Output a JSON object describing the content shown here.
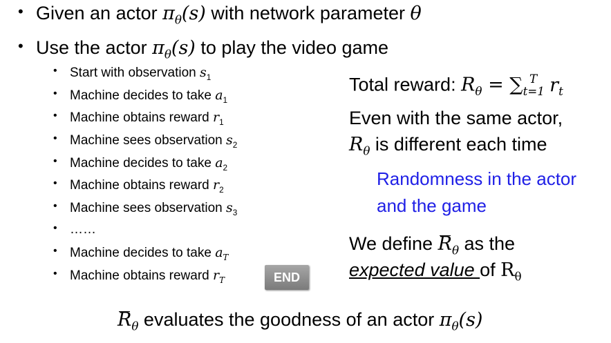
{
  "bullets_top": [
    {
      "pre": "Given an actor ",
      "actor_sym": "π",
      "actor_sub": "θ",
      "actor_arg": "(s)",
      "post": " with network parameter ",
      "param": "θ"
    },
    {
      "pre": "Use the actor ",
      "actor_sym": "π",
      "actor_sub": "θ",
      "actor_arg": "(s)",
      "post": " to play the video game"
    }
  ],
  "steps": [
    {
      "text": "Start with observation ",
      "sym": "s",
      "sub": "1"
    },
    {
      "text": "Machine decides to take ",
      "sym": "a",
      "sub": "1"
    },
    {
      "text": "Machine obtains reward ",
      "sym": "r",
      "sub": "1"
    },
    {
      "text": "Machine sees observation ",
      "sym": "s",
      "sub": "2"
    },
    {
      "text": "Machine decides to take ",
      "sym": "a",
      "sub": "2"
    },
    {
      "text": "Machine obtains reward ",
      "sym": "r",
      "sub": "2"
    },
    {
      "text": "Machine sees observation ",
      "sym": "s",
      "sub": "3"
    },
    {
      "text": "……",
      "sym": "",
      "sub": ""
    },
    {
      "text": "Machine decides to take ",
      "sym": "a",
      "sub": "T"
    },
    {
      "text": "Machine obtains reward ",
      "sym": "r",
      "sub": "T"
    }
  ],
  "end_button": "END",
  "total_reward": {
    "label": "Total reward: ",
    "R": "R",
    "sub": "θ",
    "eq": " = ∑",
    "sum_sub": "t=1",
    "sum_sup": "T",
    "r": "r",
    "r_sub": "t"
  },
  "same_actor": {
    "line1": "Even with the same actor,",
    "R": "R",
    "sub": "θ",
    "line2": " is different each time"
  },
  "randomness": {
    "line1": "Randomness in the actor",
    "line2": "and the game"
  },
  "define": {
    "pre": "We define ",
    "R": "R",
    "sub": "θ",
    "post": " as the",
    "expected": "expected value ",
    "of": "of ",
    "R2": "R",
    "sub2": "θ"
  },
  "bottom": {
    "R": "R",
    "sub": "θ",
    "text": " evaluates the goodness of an actor ",
    "actor_sym": "π",
    "actor_sub": "θ",
    "actor_arg": "(s)"
  }
}
